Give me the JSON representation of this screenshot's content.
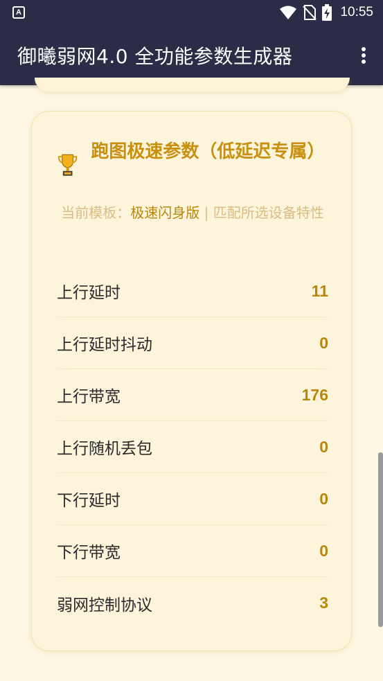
{
  "status_bar": {
    "notification_icon": "A",
    "time": "10:55",
    "icons": [
      "wifi-icon",
      "no-sim-icon",
      "battery-charging-icon"
    ]
  },
  "app_bar": {
    "title": "御曦弱网4.0 全功能参数生成器",
    "menu_icon": "more-vert-icon"
  },
  "card": {
    "icon": "trophy-icon",
    "title": "跑图极速参数（低延迟专属）",
    "template_prefix": "当前模板：",
    "template_name": "极速闪身版",
    "template_suffix": " | 匹配所选设备特性",
    "params": [
      {
        "label": "上行延时",
        "value": "11"
      },
      {
        "label": "上行延时抖动",
        "value": "0"
      },
      {
        "label": "上行带宽",
        "value": "176"
      },
      {
        "label": "上行随机丢包",
        "value": "0"
      },
      {
        "label": "下行延时",
        "value": "0"
      },
      {
        "label": "下行带宽",
        "value": "0"
      },
      {
        "label": "弱网控制协议",
        "value": "3"
      }
    ]
  },
  "colors": {
    "app_bar": "#2a2d45",
    "background": "#fdf7e4",
    "accent": "#c99010",
    "value": "#b8860b"
  }
}
